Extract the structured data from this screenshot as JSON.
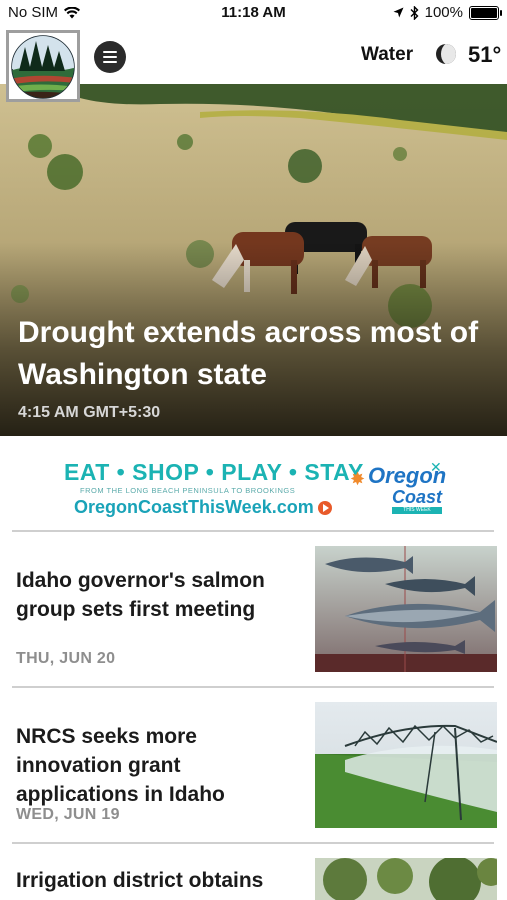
{
  "status_bar": {
    "carrier": "No SIM",
    "time": "11:18 AM",
    "battery": "100%"
  },
  "header": {
    "section": "Water",
    "temperature": "51°"
  },
  "hero": {
    "title": "Drought extends across most of Washington state",
    "time": "4:15 AM GMT+5:30"
  },
  "ad": {
    "headline": "EAT • SHOP • PLAY • STAY",
    "tagline": "FROM THE LONG BEACH PENINSULA TO BROOKINGS",
    "url": "OregonCoastThisWeek.com",
    "brand_top": "Oregon",
    "brand_bottom": "Coast",
    "brand_sub": "THIS WEEK"
  },
  "stories": [
    {
      "title": "Idaho governor's salmon group sets first meeting",
      "date": "THU, JUN 20"
    },
    {
      "title": "NRCS seeks more innovation grant applications in Idaho",
      "date": "WED, JUN 19"
    },
    {
      "title": "Irrigation district obtains",
      "date": ""
    }
  ],
  "icons": [
    "wifi-icon",
    "location-arrow-icon",
    "bluetooth-icon",
    "battery-icon",
    "menu-icon",
    "moon-icon",
    "close-icon",
    "play-icon"
  ]
}
